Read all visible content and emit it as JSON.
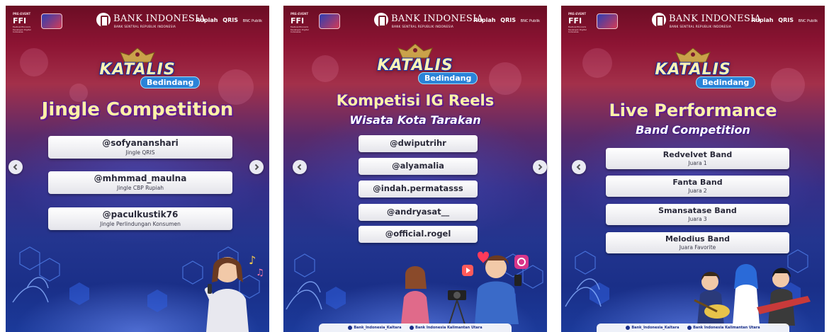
{
  "shared": {
    "ffi_logo_pre": "PRE-EVENT",
    "ffi_logo": "FFI",
    "ffi_logo_sub": "Festival Ekonomi Keuangan Digital Indonesia",
    "bank_name": "BANK INDONESIA",
    "bank_subtitle": "BANK SENTRAL REPUBLIK INDONESIA",
    "partner_1": "Rupiah",
    "partner_2": "QRIS",
    "partner_3": "BNC\nPublik",
    "katalis_word": "KATALIS",
    "katalis_tag": "Bedindang"
  },
  "cards": [
    {
      "title": "Jingle Competition",
      "entries": [
        {
          "name": "@sofyananshari",
          "detail": "Jingle QRIS"
        },
        {
          "name": "@mhmmad_maulna",
          "detail": "Jingle CBP Rupiah"
        },
        {
          "name": "@paculkustik76",
          "detail": "Jingle Perlindungan Konsumen"
        }
      ]
    },
    {
      "title": "Kompetisi IG Reels",
      "subtitle": "Wisata Kota Tarakan",
      "entries": [
        {
          "name": "@dwiputrihr"
        },
        {
          "name": "@alyamalia"
        },
        {
          "name": "@indah.permatasss"
        },
        {
          "name": "@andryasat__"
        },
        {
          "name": "@official.rogel"
        }
      ],
      "footer": [
        "Bank_Indonesia_Kaltara",
        "Bank Indonesia Kalimantan Utara"
      ]
    },
    {
      "title": "Live Performance",
      "subtitle": "Band Competition",
      "entries": [
        {
          "name": "Redvelvet Band",
          "detail": "Juara 1"
        },
        {
          "name": "Fanta Band",
          "detail": "Juara 2"
        },
        {
          "name": "Smansatase Band",
          "detail": "Juara 3"
        },
        {
          "name": "Melodius Band",
          "detail": "Juara Favorite"
        }
      ],
      "footer": [
        "Bank_Indonesia_Kaltara",
        "Bank Indonesia Kalimantan Utara"
      ]
    }
  ],
  "colors": {
    "title_yellow": "#fff1a6",
    "brand_blue": "#1a2f88",
    "brand_red": "#8d1433"
  },
  "icons": [
    "chevron-left-icon",
    "chevron-right-icon",
    "music-note-icon",
    "heart-icon",
    "instagram-icon",
    "play-icon"
  ]
}
